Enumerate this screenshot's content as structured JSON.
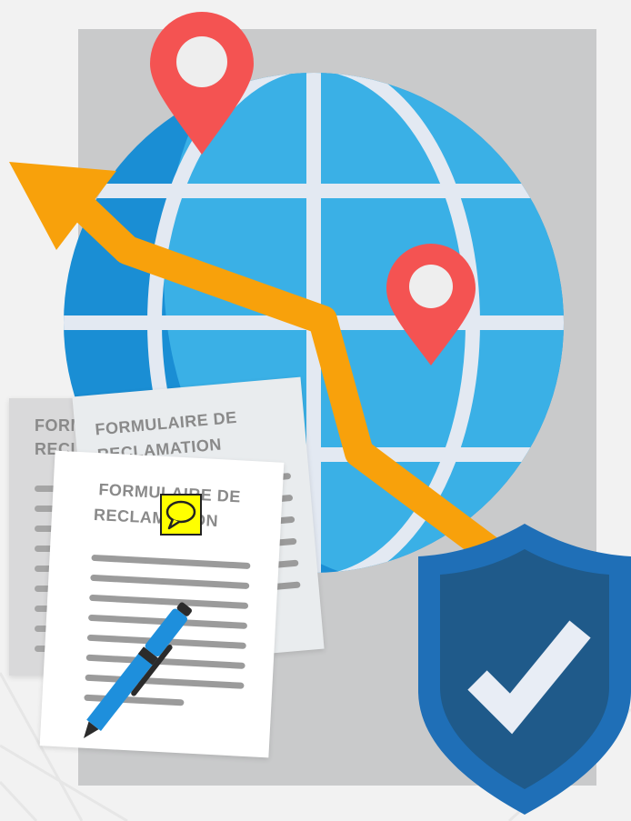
{
  "documents": {
    "back": {
      "title_line1": "FORM",
      "title_line2": "RECLA"
    },
    "middle": {
      "title_line1": "FORMULAIRE DE",
      "title_line2": "RECLAMATION"
    },
    "front": {
      "title_line1": "FORMULAIRE DE",
      "title_line2": "RECLAMATION"
    }
  },
  "icons": {
    "globe": "globe-icon",
    "pins": [
      "map-pin-icon",
      "map-pin-icon"
    ],
    "arrow": "trend-arrow-icon",
    "pen": "pen-icon",
    "shield": "shield-check-icon",
    "comment": "comment-icon"
  },
  "colors": {
    "globe_dark": "#1a8ed4",
    "globe_light": "#3ab0e6",
    "grid": "#e3e9f2",
    "pin": "#f45352",
    "arrow": "#f8a10b",
    "shield_outer": "#1f6fb7",
    "shield_inner": "#1f5a8a",
    "check": "#e8edf5",
    "pen": "#1e8fdc"
  }
}
